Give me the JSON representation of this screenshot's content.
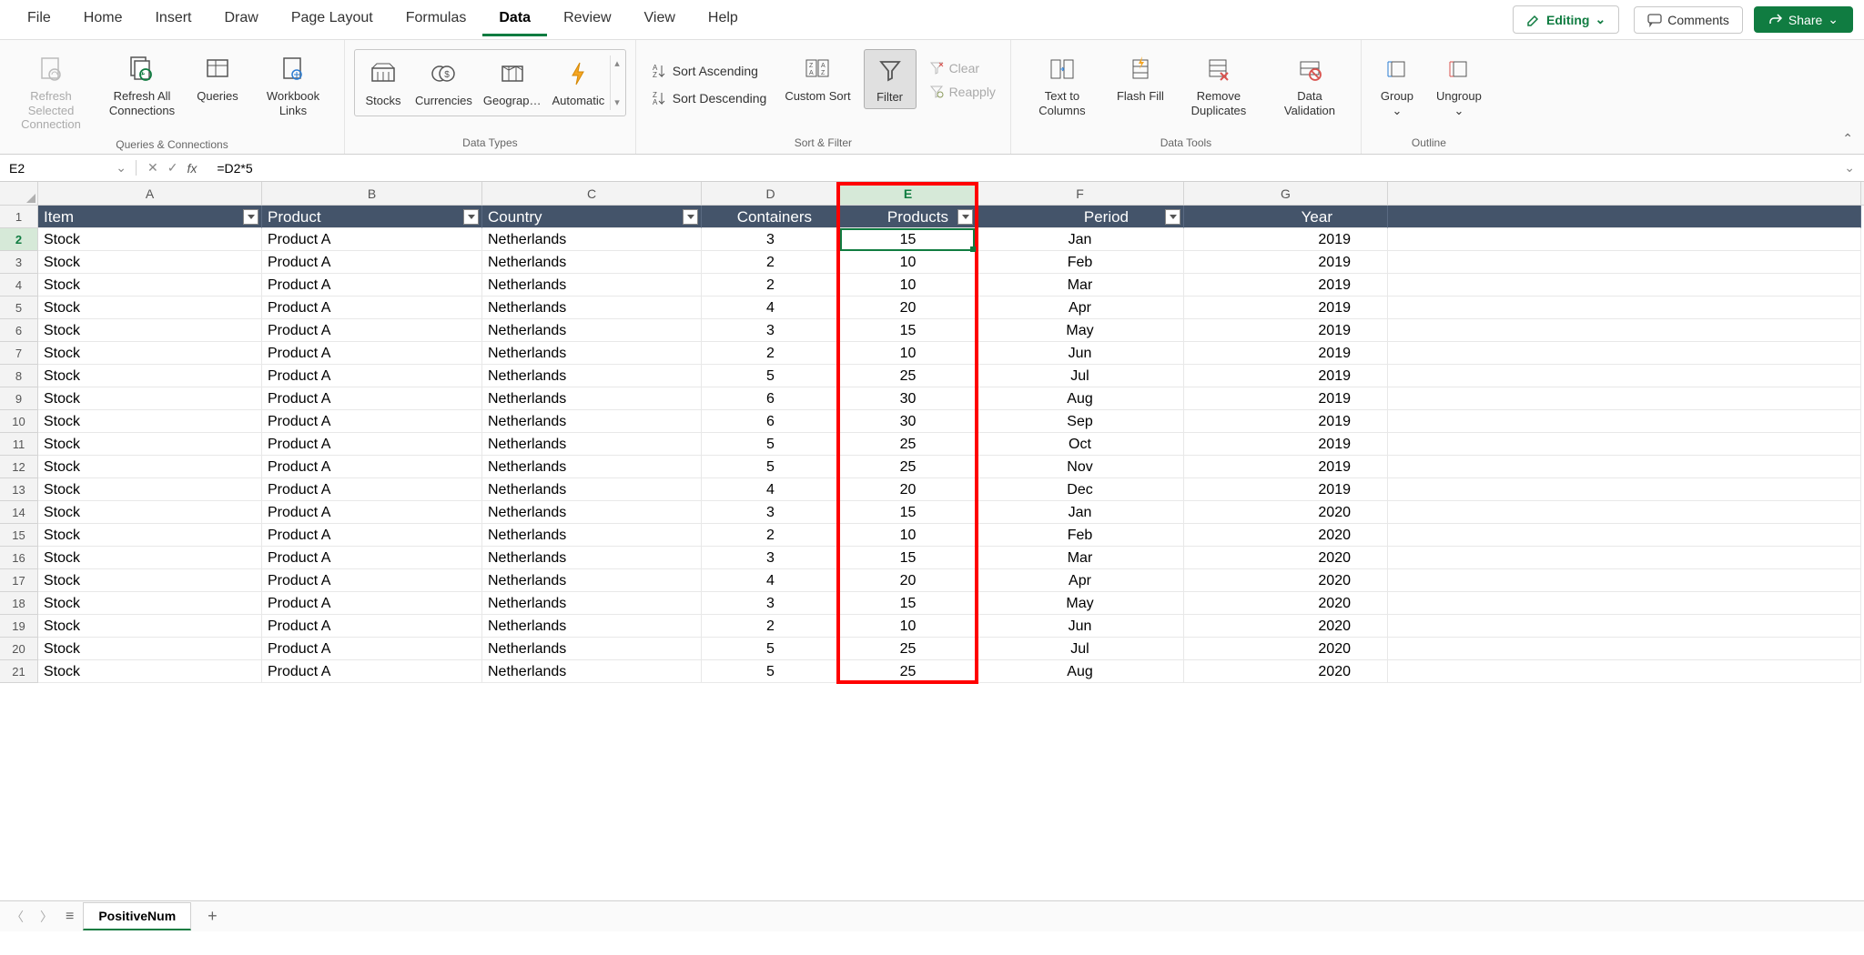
{
  "menu": {
    "items": [
      "File",
      "Home",
      "Insert",
      "Draw",
      "Page Layout",
      "Formulas",
      "Data",
      "Review",
      "View",
      "Help"
    ],
    "active": "Data",
    "editing": "Editing",
    "comments": "Comments",
    "share": "Share"
  },
  "ribbon": {
    "queries": {
      "refresh_sel": "Refresh Selected\nConnection",
      "refresh_all": "Refresh All\nConnections",
      "queries": "Queries",
      "workbook_links": "Workbook\nLinks",
      "label": "Queries & Connections"
    },
    "datatypes": {
      "stocks": "Stocks",
      "currencies": "Currencies",
      "geography": "Geograp…",
      "automatic": "Automatic",
      "label": "Data Types"
    },
    "sortfilter": {
      "asc": "Sort Ascending",
      "desc": "Sort Descending",
      "custom": "Custom\nSort",
      "filter": "Filter",
      "clear": "Clear",
      "reapply": "Reapply",
      "label": "Sort & Filter"
    },
    "datatools": {
      "text_to_cols": "Text to\nColumns",
      "flash_fill": "Flash\nFill",
      "remove_dup": "Remove\nDuplicates",
      "validation": "Data\nValidation",
      "label": "Data Tools"
    },
    "outline": {
      "group": "Group",
      "ungroup": "Ungroup",
      "label": "Outline"
    }
  },
  "formula_bar": {
    "cell_ref": "E2",
    "formula": "=D2*5"
  },
  "columns": [
    "A",
    "B",
    "C",
    "D",
    "E",
    "F",
    "G"
  ],
  "selected_column": "E",
  "headers": {
    "A": "Item",
    "B": "Product",
    "C": "Country",
    "D": "Containers",
    "E": "Products",
    "F": "Period",
    "G": "Year"
  },
  "rows": [
    {
      "n": 2,
      "A": "Stock",
      "B": "Product A",
      "C": "Netherlands",
      "D": "3",
      "E": "15",
      "F": "Jan",
      "G": "2019"
    },
    {
      "n": 3,
      "A": "Stock",
      "B": "Product A",
      "C": "Netherlands",
      "D": "2",
      "E": "10",
      "F": "Feb",
      "G": "2019"
    },
    {
      "n": 4,
      "A": "Stock",
      "B": "Product A",
      "C": "Netherlands",
      "D": "2",
      "E": "10",
      "F": "Mar",
      "G": "2019"
    },
    {
      "n": 5,
      "A": "Stock",
      "B": "Product A",
      "C": "Netherlands",
      "D": "4",
      "E": "20",
      "F": "Apr",
      "G": "2019"
    },
    {
      "n": 6,
      "A": "Stock",
      "B": "Product A",
      "C": "Netherlands",
      "D": "3",
      "E": "15",
      "F": "May",
      "G": "2019"
    },
    {
      "n": 7,
      "A": "Stock",
      "B": "Product A",
      "C": "Netherlands",
      "D": "2",
      "E": "10",
      "F": "Jun",
      "G": "2019"
    },
    {
      "n": 8,
      "A": "Stock",
      "B": "Product A",
      "C": "Netherlands",
      "D": "5",
      "E": "25",
      "F": "Jul",
      "G": "2019"
    },
    {
      "n": 9,
      "A": "Stock",
      "B": "Product A",
      "C": "Netherlands",
      "D": "6",
      "E": "30",
      "F": "Aug",
      "G": "2019"
    },
    {
      "n": 10,
      "A": "Stock",
      "B": "Product A",
      "C": "Netherlands",
      "D": "6",
      "E": "30",
      "F": "Sep",
      "G": "2019"
    },
    {
      "n": 11,
      "A": "Stock",
      "B": "Product A",
      "C": "Netherlands",
      "D": "5",
      "E": "25",
      "F": "Oct",
      "G": "2019"
    },
    {
      "n": 12,
      "A": "Stock",
      "B": "Product A",
      "C": "Netherlands",
      "D": "5",
      "E": "25",
      "F": "Nov",
      "G": "2019"
    },
    {
      "n": 13,
      "A": "Stock",
      "B": "Product A",
      "C": "Netherlands",
      "D": "4",
      "E": "20",
      "F": "Dec",
      "G": "2019"
    },
    {
      "n": 14,
      "A": "Stock",
      "B": "Product A",
      "C": "Netherlands",
      "D": "3",
      "E": "15",
      "F": "Jan",
      "G": "2020"
    },
    {
      "n": 15,
      "A": "Stock",
      "B": "Product A",
      "C": "Netherlands",
      "D": "2",
      "E": "10",
      "F": "Feb",
      "G": "2020"
    },
    {
      "n": 16,
      "A": "Stock",
      "B": "Product A",
      "C": "Netherlands",
      "D": "3",
      "E": "15",
      "F": "Mar",
      "G": "2020"
    },
    {
      "n": 17,
      "A": "Stock",
      "B": "Product A",
      "C": "Netherlands",
      "D": "4",
      "E": "20",
      "F": "Apr",
      "G": "2020"
    },
    {
      "n": 18,
      "A": "Stock",
      "B": "Product A",
      "C": "Netherlands",
      "D": "3",
      "E": "15",
      "F": "May",
      "G": "2020"
    },
    {
      "n": 19,
      "A": "Stock",
      "B": "Product A",
      "C": "Netherlands",
      "D": "2",
      "E": "10",
      "F": "Jun",
      "G": "2020"
    },
    {
      "n": 20,
      "A": "Stock",
      "B": "Product A",
      "C": "Netherlands",
      "D": "5",
      "E": "25",
      "F": "Jul",
      "G": "2020"
    },
    {
      "n": 21,
      "A": "Stock",
      "B": "Product A",
      "C": "Netherlands",
      "D": "5",
      "E": "25",
      "F": "Aug",
      "G": "2020"
    }
  ],
  "sheet": {
    "name": "PositiveNum"
  }
}
